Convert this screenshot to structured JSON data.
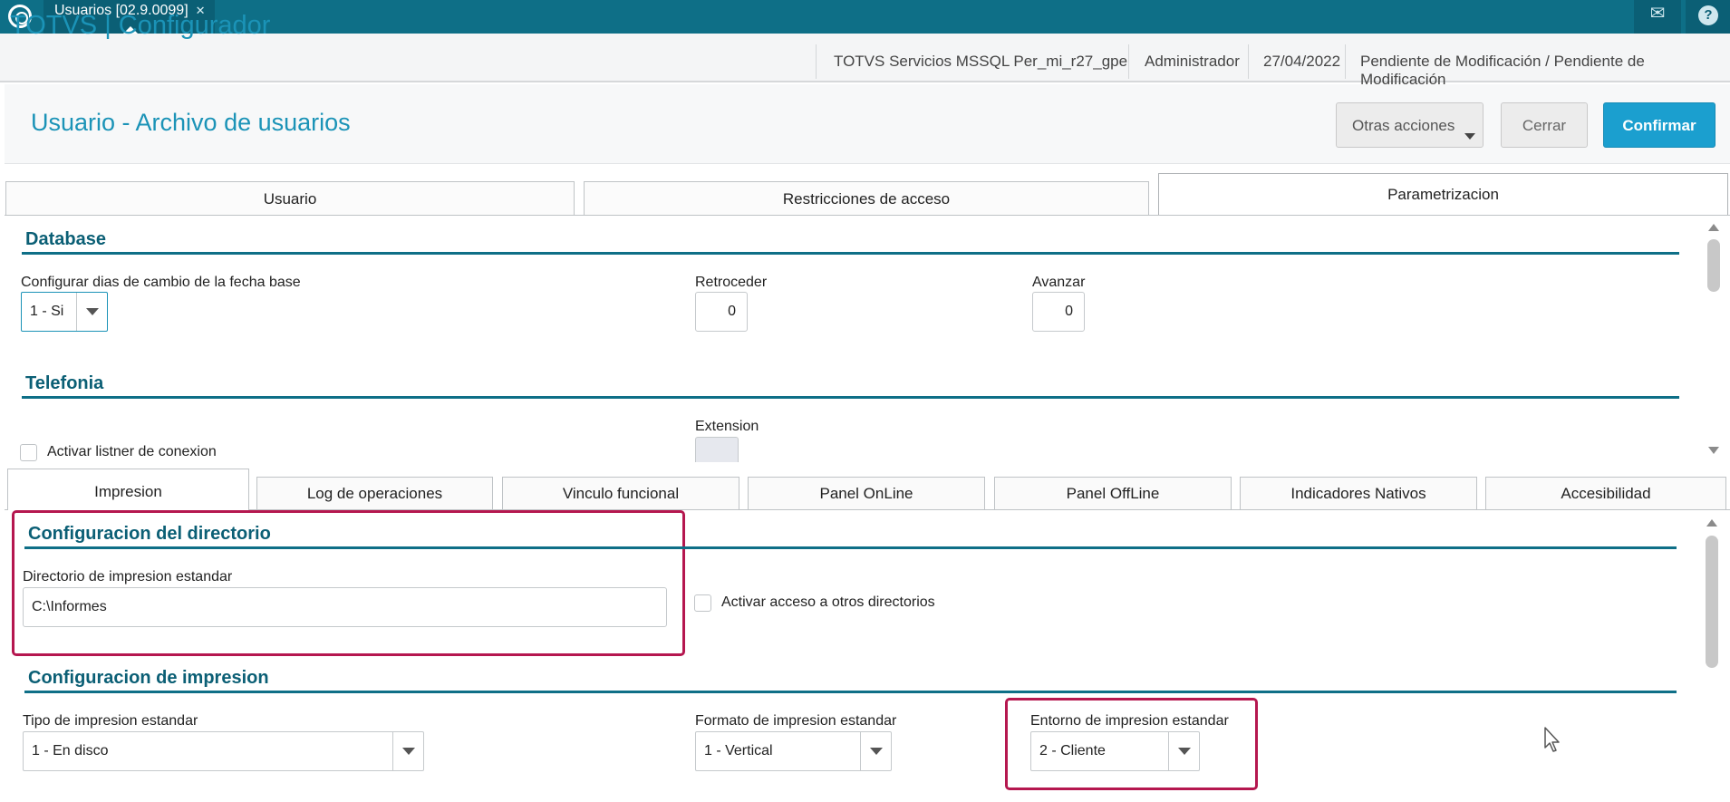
{
  "topbar": {
    "tab_label": "Usuarios [02.9.0099]",
    "tab_close": "✕",
    "mail_icon": "envelope-icon",
    "help_icon": "question-icon",
    "help_glyph": "?"
  },
  "header": {
    "brand": "TOTVS | Configurador",
    "environment": "TOTVS Servicios MSSQL Per_mi_r27_gpe",
    "user": "Administrador",
    "date": "27/04/2022",
    "status": "Pendiente de Modificación / Pendiente de Modificación"
  },
  "page": {
    "title": "Usuario - Archivo de usuarios"
  },
  "actions": {
    "otras_acciones": "Otras acciones",
    "cerrar": "Cerrar",
    "confirmar": "Confirmar"
  },
  "main_tabs": [
    {
      "label": "Usuario",
      "active": false
    },
    {
      "label": "Restricciones de acceso",
      "active": false
    },
    {
      "label": "Parametrizacion",
      "active": true
    }
  ],
  "database": {
    "title": "Database",
    "config_dias_label": "Configurar dias de cambio de la fecha base",
    "config_dias_value": "1 - Si",
    "retroceder_label": "Retroceder",
    "retroceder_value": "0",
    "avanzar_label": "Avanzar",
    "avanzar_value": "0"
  },
  "telefonia": {
    "title": "Telefonia",
    "listener_label": "Activar listner de conexion",
    "extension_label": "Extension"
  },
  "sub_tabs": [
    {
      "label": "Impresion",
      "active": true
    },
    {
      "label": "Log de operaciones",
      "active": false
    },
    {
      "label": "Vinculo funcional",
      "active": false
    },
    {
      "label": "Panel OnLine",
      "active": false
    },
    {
      "label": "Panel OffLine",
      "active": false
    },
    {
      "label": "Indicadores Nativos",
      "active": false
    },
    {
      "label": "Accesibilidad",
      "active": false
    }
  ],
  "directorio": {
    "title": "Configuracion del directorio",
    "dir_label": "Directorio de impresion estandar",
    "dir_value": "C:\\Informes",
    "otros_label": "Activar acceso a otros directorios"
  },
  "impresion": {
    "title": "Configuracion de impresion",
    "tipo_label": "Tipo de impresion estandar",
    "tipo_value": "1 - En disco",
    "formato_label": "Formato de impresion estandar",
    "formato_value": "1 - Vertical",
    "entorno_label": "Entorno de impresion estandar",
    "entorno_value": "2 - Cliente"
  },
  "colors": {
    "topbar": "#0e6f87",
    "accent": "#1b93b7",
    "primary_button": "#1b9fcf",
    "section_title": "#0b5f75",
    "highlight": "#b5174f"
  }
}
